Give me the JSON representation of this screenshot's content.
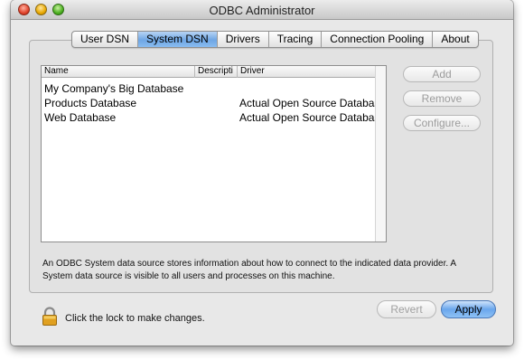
{
  "window": {
    "title": "ODBC Administrator"
  },
  "tabs": [
    {
      "label": "User DSN",
      "active": false
    },
    {
      "label": "System DSN",
      "active": true
    },
    {
      "label": "Drivers",
      "active": false
    },
    {
      "label": "Tracing",
      "active": false
    },
    {
      "label": "Connection Pooling",
      "active": false
    },
    {
      "label": "About",
      "active": false
    }
  ],
  "list": {
    "columns": {
      "name": "Name",
      "description": "Descripti",
      "driver": "Driver"
    },
    "rows": [
      {
        "name": "My Company's Big Database",
        "description": "",
        "driver": ""
      },
      {
        "name": "Products Database",
        "description": "",
        "driver": "Actual Open Source Databases"
      },
      {
        "name": "Web Database",
        "description": "",
        "driver": "Actual Open Source Databases"
      }
    ]
  },
  "side_buttons": {
    "add": "Add",
    "remove": "Remove",
    "configure": "Configure..."
  },
  "description": "An ODBC System data source stores information about how to connect to the indicated data provider. A System data source is visible to all users and processes on this machine.",
  "lock_text": "Click the lock to make changes.",
  "buttons": {
    "revert": "Revert",
    "apply": "Apply"
  }
}
